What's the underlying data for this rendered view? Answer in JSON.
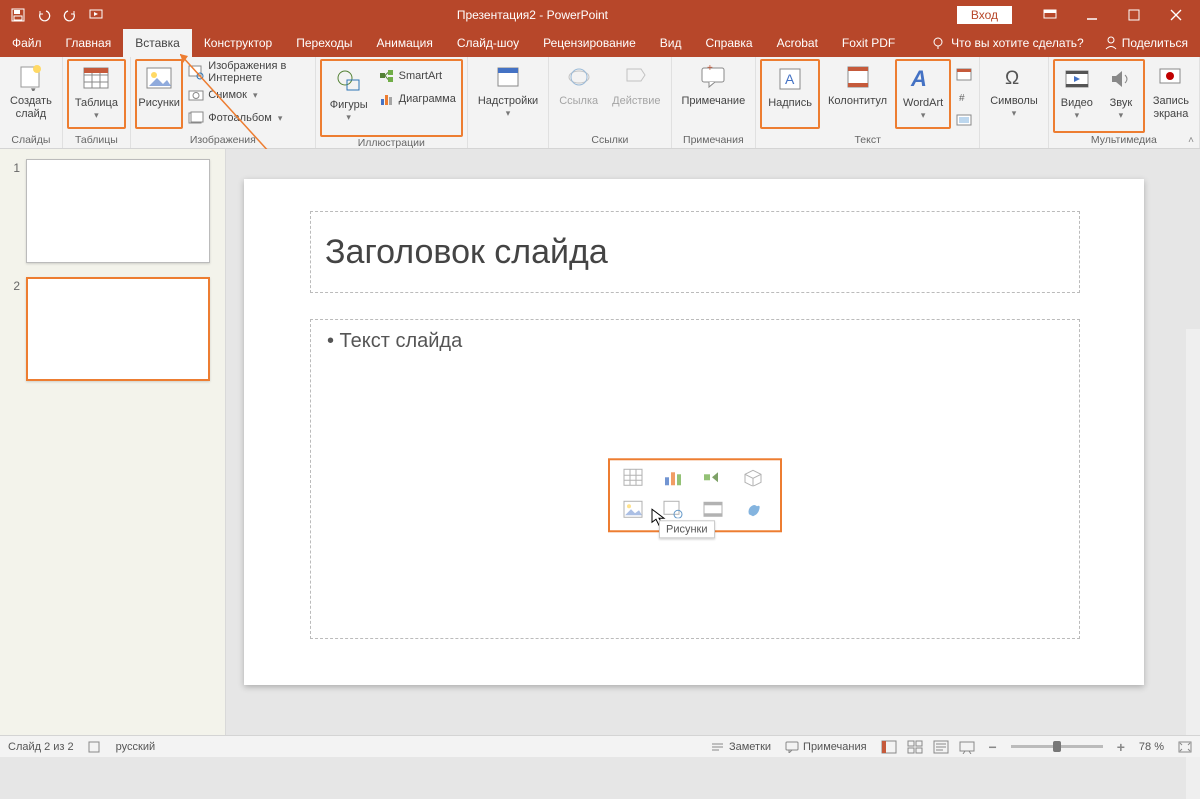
{
  "app": {
    "title": "Презентация2  -  PowerPoint",
    "signin": "Вход"
  },
  "tabs": {
    "file": "Файл",
    "home": "Главная",
    "insert": "Вставка",
    "design": "Конструктор",
    "trans": "Переходы",
    "anim": "Анимация",
    "show": "Слайд-шоу",
    "review": "Рецензирование",
    "view": "Вид",
    "help": "Справка",
    "acro": "Acrobat",
    "foxit": "Foxit PDF",
    "tellme": "Что вы хотите сделать?",
    "share": "Поделиться"
  },
  "ribbon": {
    "slides": {
      "new": "Создать\nслайд",
      "label": "Слайды"
    },
    "tables": {
      "table": "Таблица",
      "label": "Таблицы"
    },
    "images": {
      "pictures": "Рисунки",
      "online": "Изображения в Интернете",
      "screenshot": "Снимок",
      "album": "Фотоальбом",
      "label": "Изображения"
    },
    "illus": {
      "shapes": "Фигуры",
      "smartart": "SmartArt",
      "chart": "Диаграмма",
      "label": "Иллюстрации"
    },
    "addins": {
      "addins": "Надстройки",
      "label": ""
    },
    "links": {
      "link": "Ссылка",
      "action": "Действие",
      "label": "Ссылки"
    },
    "comments": {
      "comment": "Примечание",
      "label": "Примечания"
    },
    "text": {
      "textbox": "Надпись",
      "headerfooter": "Колонтитул",
      "wordart": "WordArt",
      "label": "Текст"
    },
    "symbols": {
      "symbols": "Символы",
      "label": ""
    },
    "media": {
      "video": "Видео",
      "audio": "Звук",
      "screenrec": "Запись\nэкрана",
      "label": "Мультимедиа"
    }
  },
  "slide": {
    "title": "Заголовок слайда",
    "body": "• Текст слайда",
    "tooltip": "Рисунки"
  },
  "thumbs": {
    "n1": "1",
    "n2": "2"
  },
  "status": {
    "slide": "Слайд 2 из 2",
    "lang": "русский",
    "notes": "Заметки",
    "comments": "Примечания",
    "zoom": "78 %"
  }
}
